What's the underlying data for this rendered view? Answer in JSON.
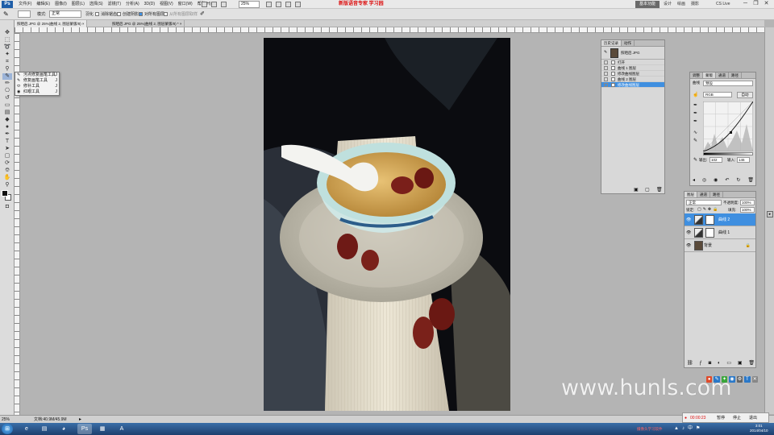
{
  "menubar": {
    "logo": "Ps",
    "menus": [
      "文件(F)",
      "编辑(E)",
      "图像(I)",
      "图层(L)",
      "选择(S)",
      "滤镜(T)",
      "分析(A)",
      "3D(D)",
      "视图(V)",
      "窗口(W)",
      "帮助(H)"
    ],
    "zoom": "25%",
    "document_title": "新版语音专家  学习园",
    "workspace_active": "基本功能",
    "workspace_items": [
      "设计",
      "绘画",
      "摄影"
    ],
    "cs_live": "CS Live",
    "window_controls": [
      "─",
      "❐",
      "✕"
    ]
  },
  "options": {
    "mode_label": "模式:",
    "mode_value": "正常",
    "feather_label": "羽化",
    "check1": "消除锯齿",
    "check2": "创建阴影",
    "check3": "对所有图层",
    "disabled_check": "从所有图层取样"
  },
  "tabs": [
    {
      "label": "照晒后.JPG @ 25%(曲线 2, 图层蒙版/8) ×"
    },
    {
      "label": "照晒后.JPG @ 25%(曲线 2, 图层蒙版/8) *  ×"
    }
  ],
  "tool_flyout": {
    "items": [
      {
        "icon": "✎",
        "label": "污点修复画笔工具",
        "key": "J"
      },
      {
        "icon": "✎",
        "label": "修复画笔工具",
        "key": "J"
      },
      {
        "icon": "⬭",
        "label": "修补工具",
        "key": "J"
      },
      {
        "icon": "◉",
        "label": "红眼工具",
        "key": "J"
      }
    ]
  },
  "history": {
    "tabs": [
      "历史记录",
      "动作"
    ],
    "snapshot": "照晒后.JPG",
    "rows": [
      {
        "label": "打开",
        "selected": false
      },
      {
        "label": "曲线 1 图层",
        "selected": false
      },
      {
        "label": "修改曲线图层",
        "selected": false
      },
      {
        "label": "曲线 2 图层",
        "selected": false
      },
      {
        "label": "修改曲线图层",
        "selected": true
      }
    ]
  },
  "adjustments": {
    "tabs": [
      "调整",
      "蒙版",
      "通道",
      "路径"
    ],
    "preset_label": "曲线",
    "preset_value": "预设",
    "channel_value": "RGB",
    "auto_button": "自动",
    "output_label": "输出:",
    "output_value": "102",
    "input_label": "输入:",
    "input_value": "146"
  },
  "layers": {
    "tabs": [
      "图层",
      "通道",
      "路径"
    ],
    "blend_mode": "正常",
    "opacity_label": "不透明度:",
    "opacity_value": "100%",
    "fill_label": "填充:",
    "fill_value": "100%",
    "lock_label": "锁定:",
    "rows": [
      {
        "name": "曲线 2",
        "selected": true,
        "type": "adjustment"
      },
      {
        "name": "曲线 1",
        "selected": false,
        "type": "adjustment"
      },
      {
        "name": "背景",
        "selected": false,
        "type": "background"
      }
    ]
  },
  "status": {
    "zoom": "25%",
    "doc": "文档:40.9M/45.9M"
  },
  "watermark": "www.hunls.com",
  "recorder": {
    "time": "00:00:23",
    "buttons": [
      "暂停",
      "停止",
      "退出"
    ]
  },
  "taskbar": {
    "time": "3:01",
    "date": "2014/04/10",
    "note": "摄像头学习软件"
  }
}
